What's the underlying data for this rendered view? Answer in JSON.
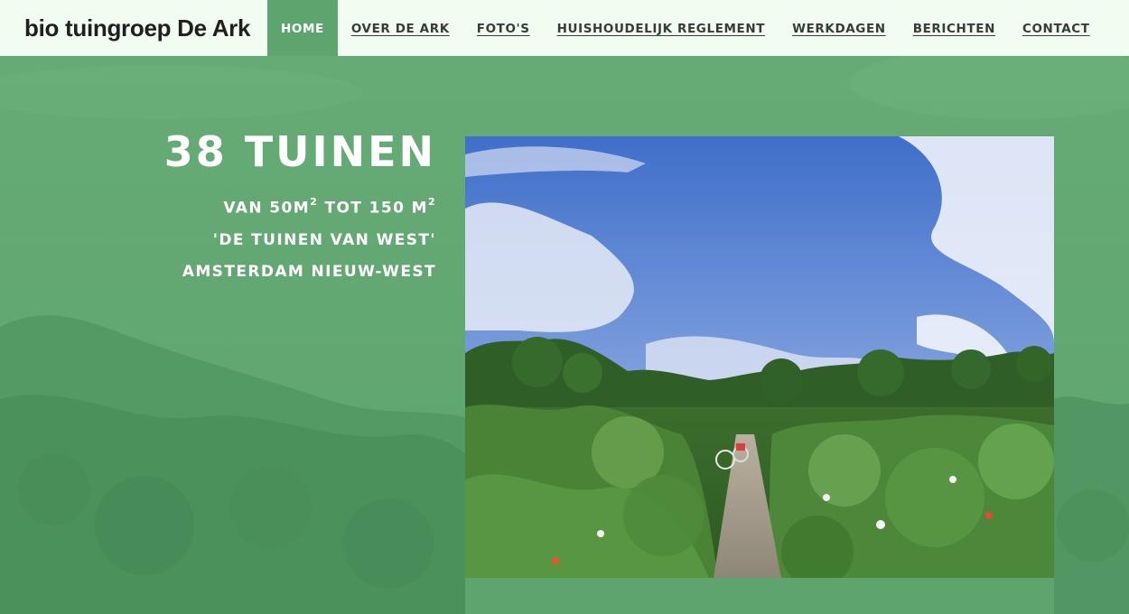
{
  "site": {
    "brand": "bio tuingroep De Ark"
  },
  "nav": {
    "items": [
      {
        "label": "HOME",
        "active": true
      },
      {
        "label": "OVER DE ARK",
        "active": false
      },
      {
        "label": "FOTO'S",
        "active": false
      },
      {
        "label": "HUISHOUDELIJK REGLEMENT",
        "active": false
      },
      {
        "label": "WERKDAGEN",
        "active": false
      },
      {
        "label": "BERICHTEN",
        "active": false
      },
      {
        "label": "CONTACT",
        "active": false
      }
    ]
  },
  "hero": {
    "title": "38 TUINEN",
    "size_line_a": "VAN 50M",
    "size_sup_a": "2",
    "size_line_b": " TOT 150 M",
    "size_sup_b": "2",
    "line2": "'DE TUINEN VAN WEST'",
    "line3": "AMSTERDAM NIEUW-WEST"
  },
  "colors": {
    "nav_background": "#f0fdf0",
    "accent_green": "#5ea46e",
    "text_dark": "#1f1f1f"
  }
}
